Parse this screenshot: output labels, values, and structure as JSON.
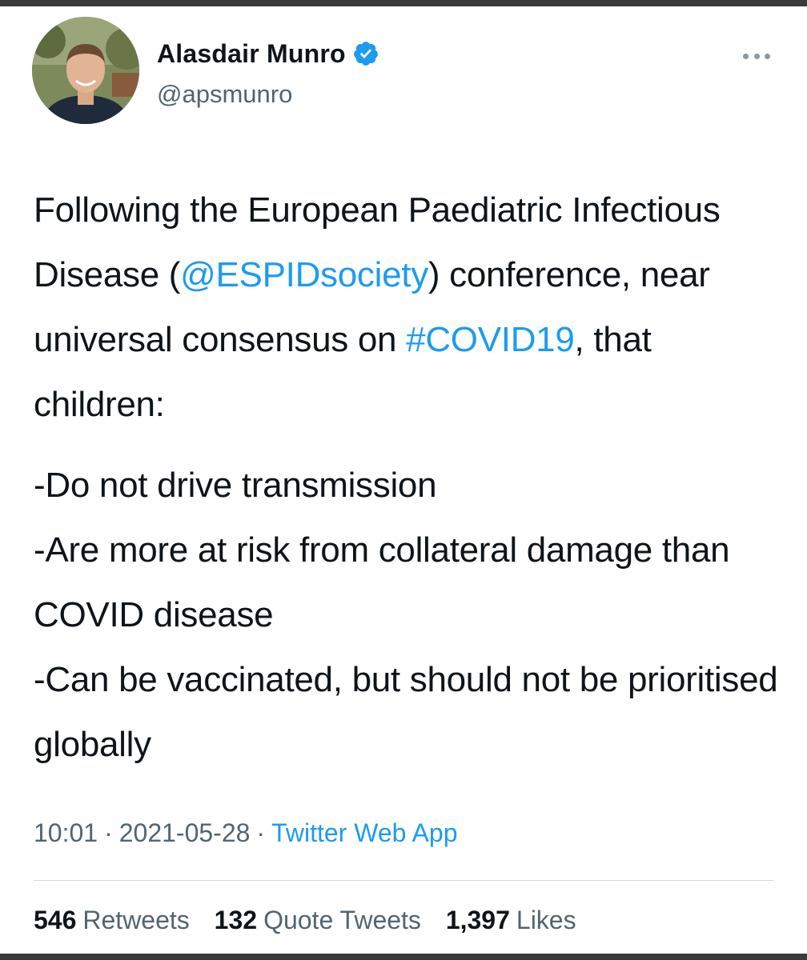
{
  "author": {
    "display_name": "Alasdair Munro",
    "handle": "@apsmunro",
    "verified": true,
    "avatar_icon": "profile-photo",
    "verified_icon": "verified-badge-icon"
  },
  "more_icon": "more-options-icon",
  "tweet": {
    "p1_before_mention": "Following the European Paediatric Infectious Disease (",
    "mention": "@ESPIDsociety",
    "p1_after_mention": ") conference, near universal consensus on ",
    "hashtag": "#COVID19",
    "p1_end": ", that children:",
    "line1": "-Do not drive transmission",
    "line2": "-Are more at risk from collateral damage than COVID disease",
    "line3": "-Can be vaccinated, but should not be prioritised globally"
  },
  "meta": {
    "time": "10:01",
    "separator": "·",
    "date": "2021-05-28",
    "source": "Twitter Web App"
  },
  "stats": {
    "retweets_count": "546",
    "retweets_label": "Retweets",
    "quotes_count": "132",
    "quotes_label": "Quote Tweets",
    "likes_count": "1,397",
    "likes_label": "Likes"
  },
  "colors": {
    "link": "#1d9bf0",
    "text": "#0f1419",
    "secondary": "#536471"
  }
}
